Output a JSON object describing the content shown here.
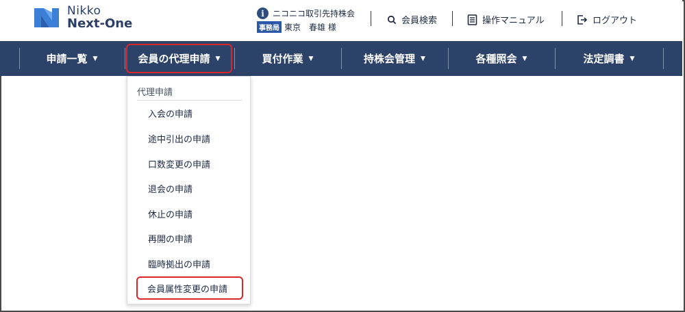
{
  "header": {
    "logo_line1": "Nikko",
    "logo_line2": "Next-One",
    "company": "ニコニコ取引先持株会",
    "role_badge": "事務局",
    "user_name": "東京　春雄 様",
    "links": {
      "member_search": "会員検索",
      "manual": "操作マニュアル",
      "logout": "ログアウト"
    }
  },
  "nav": {
    "items": [
      {
        "label": "申請一覧"
      },
      {
        "label": "会員の代理申請"
      },
      {
        "label": "買付作業"
      },
      {
        "label": "持株会管理"
      },
      {
        "label": "各種照会"
      },
      {
        "label": "法定調書"
      }
    ],
    "caret": "▼"
  },
  "dropdown": {
    "header": "代理申請",
    "items": [
      {
        "label": "入会の申請"
      },
      {
        "label": "途中引出の申請"
      },
      {
        "label": "口数変更の申請"
      },
      {
        "label": "退会の申請"
      },
      {
        "label": "休止の申請"
      },
      {
        "label": "再開の申請"
      },
      {
        "label": "臨時拠出の申請"
      },
      {
        "label": "会員属性変更の申請"
      }
    ]
  },
  "colors": {
    "nav_bg": "#2d4268",
    "highlight": "#d8262b",
    "brand_blue": "#2b3f66"
  }
}
